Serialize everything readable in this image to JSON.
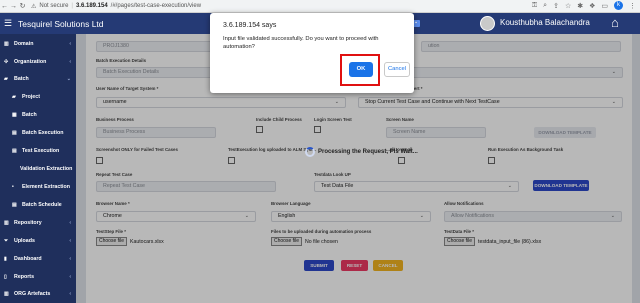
{
  "browser": {
    "security": "Not secure",
    "url_host": "3.6.189.154",
    "url_path": "/#/pages/test-case-execution/view",
    "profile_initial": "k"
  },
  "header": {
    "brand": "Tesquirel Solutions Ltd",
    "user_name": "Kousthubha Balachandra"
  },
  "sidebar": {
    "items": [
      {
        "label": "Domain",
        "icon": "bank-icon"
      },
      {
        "label": "Organization",
        "icon": "org-icon"
      },
      {
        "label": "Batch",
        "icon": "folder-icon"
      },
      {
        "label": "Project",
        "icon": "folder-icon"
      },
      {
        "label": "Batch",
        "icon": "grid-icon"
      },
      {
        "label": "Batch Execution",
        "icon": "list-icon"
      },
      {
        "label": "Test Execution",
        "icon": "list-icon"
      },
      {
        "label": "Validation Extraction",
        "icon": ""
      },
      {
        "label": "Element Extraction",
        "icon": "bullet-icon"
      },
      {
        "label": "Batch Schedule",
        "icon": "list-icon"
      },
      {
        "label": "Repository",
        "icon": "bank-icon"
      },
      {
        "label": "Uploads",
        "icon": "filter-icon"
      },
      {
        "label": "Dashboard",
        "icon": "bar-icon"
      },
      {
        "label": "Reports",
        "icon": "doc-icon"
      },
      {
        "label": "ORG Artefacts",
        "icon": "bank-icon"
      }
    ]
  },
  "form": {
    "project_value": "PROJ1380",
    "execution_value": "ution",
    "batch_exec_details_label": "Batch Execution Details",
    "batch_exec_details_placeholder": "Batch Execution Details",
    "target_user_label": "User Name of Target System *",
    "target_user_value": "username",
    "stop_error_label": "How to proceed on Stop Alert *",
    "stop_error_value": "Stop Current Test Case and Continue with Next TestCase",
    "business_process_label": "Business Process",
    "business_process_placeholder": "Business Process",
    "include_child_label": "Include Child Process",
    "login_screen_label": "Login Screen Test",
    "screen_name_label": "Screen Name",
    "screen_name_placeholder": "Screen Name",
    "download_template_disabled": "DOWNLOAD TEMPLATE",
    "screenshot_label": "Screenshot ONLY for Failed Test Cases",
    "alm_label": "TestExecution log uploaded to ALM Syst...",
    "email_label": "...ail to email",
    "background_label": "Run Execution As Background Task",
    "repeat_label": "Repeat Test Case",
    "repeat_placeholder": "Repeat Test Case",
    "testdata_label": "Testdata Look UP",
    "testdata_value": "Test Data File",
    "download_template": "DOWNLOAD TEMPLATE",
    "browser_label": "Browser Name *",
    "browser_value": "Chrome",
    "language_label": "Browser Language",
    "language_value": "English",
    "notifications_label": "Allow Notifications",
    "notifications_placeholder": "Allow Notifications",
    "teststep_label": "TestStep File *",
    "teststep_btn": "Choose file",
    "teststep_file": "Kautocars.xlsx",
    "upload_label": "Files to be uploaded during automation process",
    "upload_btn": "Choose file",
    "upload_file": "No file chosen",
    "testdata_file_label": "TestData File *",
    "testdata_btn": "Choose file",
    "testdata_file": "testdata_input_file (86).xlsx",
    "submit": "SUBMIT",
    "reset": "RESET",
    "cancel": "CANCEL"
  },
  "processing_text": "Processing the Request, Pls Wait...",
  "dialog": {
    "title": "3.6.189.154 says",
    "message": "Input file validated successfully. Do you want to proceed with automation?",
    "ok": "OK",
    "cancel": "Cancel"
  },
  "colors": {
    "header": "#253a75",
    "sidebar": "#1f2f5c",
    "submit": "#2d49c9",
    "reset": "#ef3a65",
    "cancel": "#f3b521",
    "download": "#2d49c9",
    "ok_highlight": "#e01010"
  }
}
